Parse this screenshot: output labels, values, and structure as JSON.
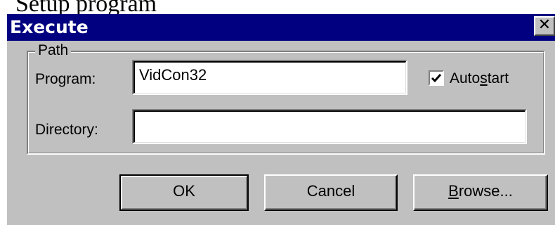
{
  "caption": "Setup program",
  "window": {
    "title": "Execute",
    "close_glyph": "✕"
  },
  "group": {
    "legend": "Path"
  },
  "fields": {
    "program_label": "Program:",
    "program_value": "VidCon32",
    "directory_label": "Directory:",
    "directory_value": ""
  },
  "autostart": {
    "prefix": "Auto",
    "mnemonic": "s",
    "suffix": "tart",
    "checked": true
  },
  "buttons": {
    "ok": "OK",
    "cancel": "Cancel",
    "browse_mnemonic": "B",
    "browse_rest": "rowse..."
  },
  "icons": {
    "close": "close-icon",
    "check": "checkmark-icon"
  }
}
